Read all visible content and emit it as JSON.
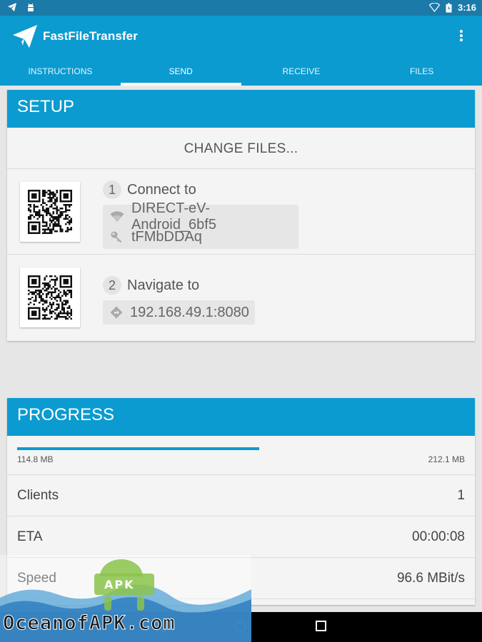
{
  "statusbar": {
    "time": "3:16"
  },
  "app": {
    "title": "FastFileTransfer"
  },
  "tabs": [
    {
      "label": "INSTRUCTIONS"
    },
    {
      "label": "SEND"
    },
    {
      "label": "RECEIVE"
    },
    {
      "label": "FILES"
    }
  ],
  "active_tab": "SEND",
  "setup": {
    "header": "SETUP",
    "change_files": "CHANGE FILES...",
    "step1": {
      "number": "1",
      "label": "Connect to",
      "ssid": "DIRECT-eV-Android_6bf5",
      "password": "tFMbDDAq"
    },
    "step2": {
      "number": "2",
      "label": "Navigate to",
      "address": "192.168.49.1:8080"
    }
  },
  "progress": {
    "header": "PROGRESS",
    "transferred": "114.8 MB",
    "total": "212.1 MB",
    "fraction": 0.541,
    "rows": [
      {
        "key": "Clients",
        "value": "1"
      },
      {
        "key": "ETA",
        "value": "00:00:08"
      },
      {
        "key": "Speed",
        "value": "96.6 MBit/s"
      }
    ]
  },
  "watermark": {
    "text": "OceanofAPK.com",
    "badge": "APK"
  },
  "colors": {
    "primary": "#0b9bd0",
    "statusbar": "#1b7aa8"
  }
}
